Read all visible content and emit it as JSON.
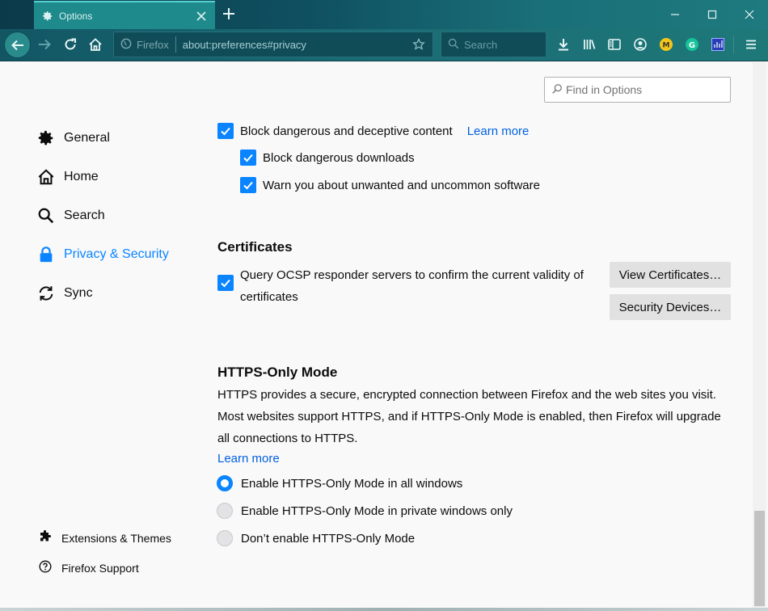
{
  "window": {
    "tab_title": "Options",
    "new_tab_icon": "plus-icon",
    "controls": [
      "minimize-icon",
      "maximize-icon",
      "close-icon"
    ]
  },
  "navbar": {
    "identity_label": "Firefox",
    "url": "about:preferences#privacy",
    "search_placeholder": "Search",
    "toolbar_icons": [
      "download-icon",
      "library-icon",
      "sidebar-icon",
      "account-icon",
      "extension-m-icon",
      "grammarly-icon",
      "extension-grid-icon",
      "menu-icon"
    ]
  },
  "find": {
    "placeholder": "Find in Options"
  },
  "sidebar": {
    "categories": [
      {
        "label": "General",
        "icon": "gear-icon"
      },
      {
        "label": "Home",
        "icon": "home-icon"
      },
      {
        "label": "Search",
        "icon": "search-icon"
      },
      {
        "label": "Privacy & Security",
        "icon": "lock-icon",
        "selected": true
      },
      {
        "label": "Sync",
        "icon": "sync-icon"
      }
    ],
    "footer": [
      {
        "label": "Extensions & Themes",
        "icon": "puzzle-icon"
      },
      {
        "label": "Firefox Support",
        "icon": "help-icon"
      }
    ]
  },
  "deceptive": {
    "block_label": "Block dangerous and deceptive content",
    "learn_more": "Learn more",
    "downloads_label": "Block dangerous downloads",
    "unwanted_label": "Warn you about unwanted and uncommon software"
  },
  "certificates": {
    "heading": "Certificates",
    "ocsp_line1": "Query OCSP responder servers to confirm the current validity of",
    "ocsp_line2": "certificates",
    "view_button": "View Certificates…",
    "devices_button": "Security Devices…"
  },
  "https_only": {
    "heading": "HTTPS-Only Mode",
    "description": "HTTPS provides a secure, encrypted connection between Firefox and the web sites you visit. Most websites support HTTPS, and if HTTPS-Only Mode is enabled, then Firefox will upgrade all connections to HTTPS.",
    "learn_more": "Learn more",
    "options": [
      {
        "label": "Enable HTTPS-Only Mode in all windows",
        "selected": true
      },
      {
        "label": "Enable HTTPS-Only Mode in private windows only",
        "selected": false
      },
      {
        "label": "Don’t enable HTTPS-Only Mode",
        "selected": false
      }
    ]
  },
  "colors": {
    "accent": "#0a84ff",
    "link": "#0060df",
    "titlebar": "#1f8a8c"
  }
}
